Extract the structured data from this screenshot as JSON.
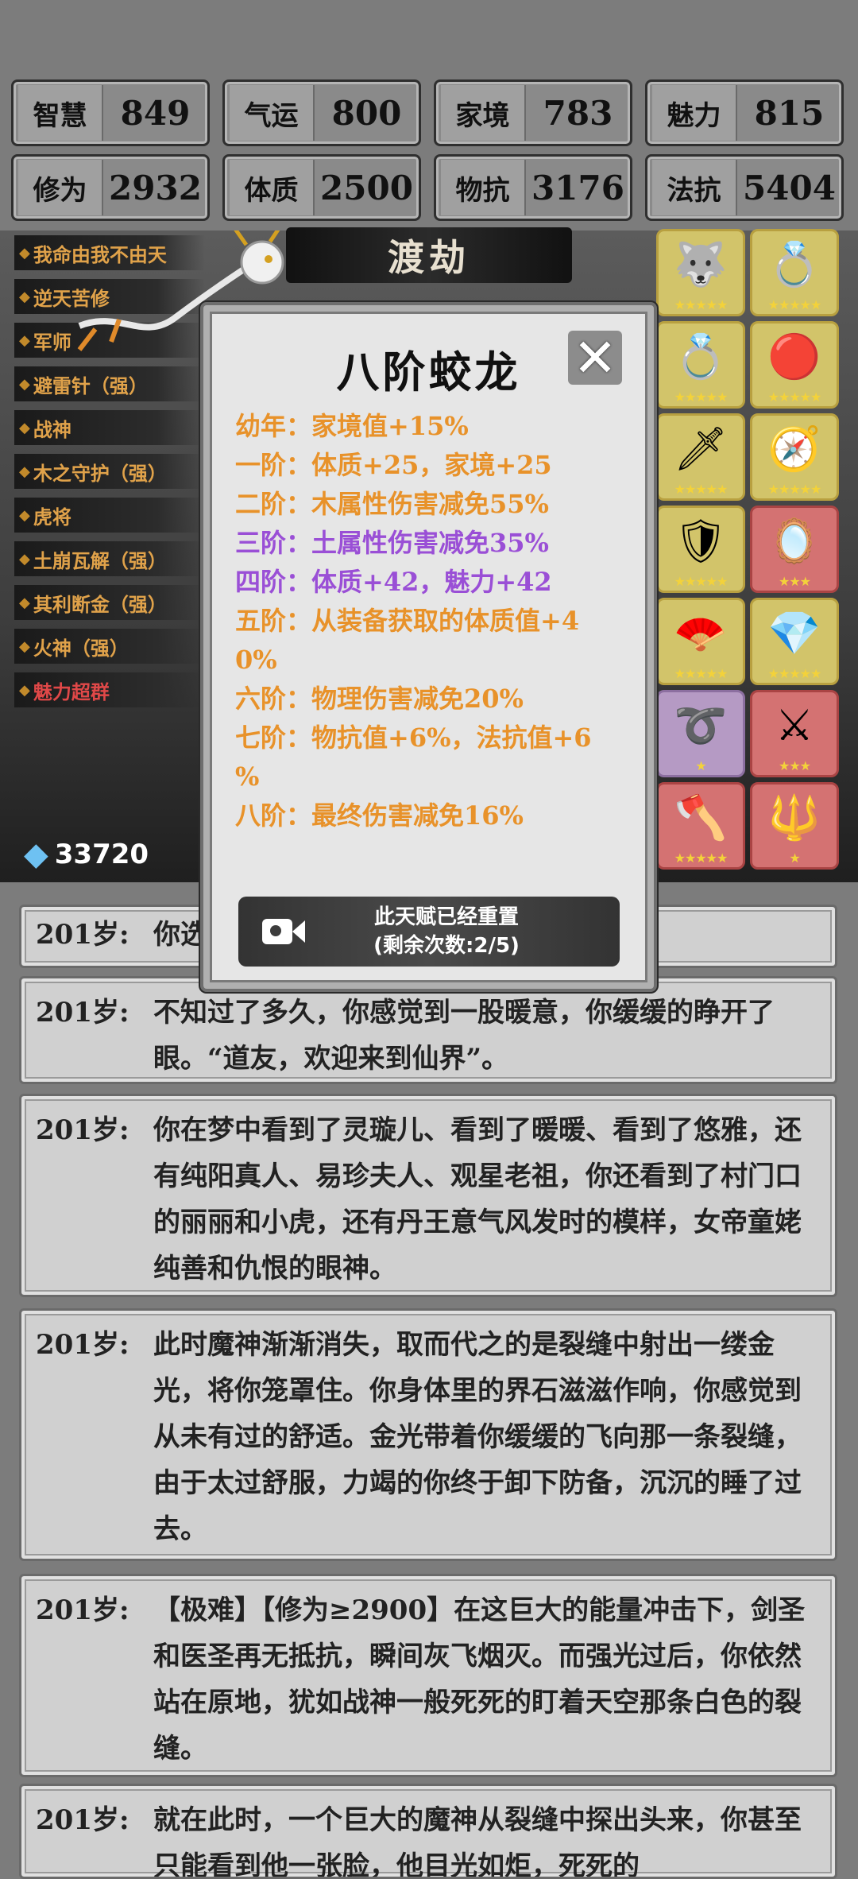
{
  "stats": [
    {
      "label": "智慧",
      "value": "849"
    },
    {
      "label": "气运",
      "value": "800"
    },
    {
      "label": "家境",
      "value": "783"
    },
    {
      "label": "魅力",
      "value": "815"
    },
    {
      "label": "修为",
      "value": "2932"
    },
    {
      "label": "体质",
      "value": "2500"
    },
    {
      "label": "物抗",
      "value": "3176"
    },
    {
      "label": "法抗",
      "value": "5404"
    }
  ],
  "talents": [
    {
      "label": "我命由我不由天"
    },
    {
      "label": "逆天苦修"
    },
    {
      "label": "军师"
    },
    {
      "label": "避雷针（强）"
    },
    {
      "label": "战神"
    },
    {
      "label": "木之守护（强）"
    },
    {
      "label": "虎将"
    },
    {
      "label": "土崩瓦解（强）"
    },
    {
      "label": "其利断金（强）"
    },
    {
      "label": "火神（强）"
    },
    {
      "label": "魅力超群",
      "color": "red"
    }
  ],
  "dujie_label": "渡劫",
  "crystal_count": "33720",
  "items": [
    {
      "icon": "beast-icon",
      "glyph": "🐺",
      "stars": "★★★★★",
      "bg": "gold"
    },
    {
      "icon": "ring-icon",
      "glyph": "💍",
      "stars": "★★★★★",
      "bg": "gold"
    },
    {
      "icon": "ruby-ring-icon",
      "glyph": "💍",
      "stars": "★★★★★",
      "bg": "gold"
    },
    {
      "icon": "red-orb-icon",
      "glyph": "🔴",
      "stars": "★★★★★",
      "bg": "gold"
    },
    {
      "icon": "blade-icon",
      "glyph": "🗡",
      "stars": "★★★★★",
      "bg": "gold"
    },
    {
      "icon": "compass-icon",
      "glyph": "🧭",
      "stars": "★★★★★",
      "bg": "gold"
    },
    {
      "icon": "armor-icon",
      "glyph": "🛡",
      "stars": "★★★★★",
      "bg": "gold"
    },
    {
      "icon": "mirror-icon",
      "glyph": "🪞",
      "stars": "★★★",
      "bg": "red"
    },
    {
      "icon": "fan-icon",
      "glyph": "🪭",
      "stars": "★★★★★",
      "bg": "gold"
    },
    {
      "icon": "crystal-icon",
      "glyph": "💎",
      "stars": "★★★★★",
      "bg": "gold"
    },
    {
      "icon": "whip-icon",
      "glyph": "➰",
      "stars": "★",
      "bg": "purple"
    },
    {
      "icon": "sword-icon",
      "glyph": "⚔",
      "stars": "★★★",
      "bg": "red"
    },
    {
      "icon": "axe-icon",
      "glyph": "🪓",
      "stars": "★★★★★",
      "bg": "red"
    },
    {
      "icon": "spear-icon",
      "glyph": "🔱",
      "stars": "★",
      "bg": "red"
    }
  ],
  "modal": {
    "title": "八阶蛟龙",
    "stages": [
      {
        "text": "幼年：家境值+15%",
        "color": "orange"
      },
      {
        "text": "一阶：体质+25，家境+25",
        "color": "orange"
      },
      {
        "text": "二阶：木属性伤害减免55%",
        "color": "orange"
      },
      {
        "text": "三阶：土属性伤害减免35%",
        "color": "purple"
      },
      {
        "text": "四阶：体质+42，魅力+42",
        "color": "purple"
      },
      {
        "text": "五阶：从装备获取的体质值+4",
        "color": "orange"
      },
      {
        "text": "0%",
        "color": "orange"
      },
      {
        "text": "六阶：物理伤害减免20%",
        "color": "orange"
      },
      {
        "text": "七阶：物抗值+6%，法抗值+6",
        "color": "orange"
      },
      {
        "text": "%",
        "color": "orange"
      },
      {
        "text": "八阶：最终伤害减免16%",
        "color": "orange"
      }
    ],
    "reset_line1": "此天赋已经重置",
    "reset_line2": "(剩余次数:2/5)"
  },
  "log": [
    {
      "age": "201岁:",
      "text": "你选择了飞升"
    },
    {
      "age": "201岁:",
      "text": "不知过了多久，你感觉到一股暖意，你缓缓的睁开了眼。“道友，欢迎来到仙界”。"
    },
    {
      "age": "201岁:",
      "text": "你在梦中看到了灵璇儿、看到了暖暖、看到了悠雅，还有纯阳真人、易珍夫人、观星老祖，你还看到了村门口的丽丽和小虎，还有丹王意气风发时的模样，女帝童姥纯善和仇恨的眼神。"
    },
    {
      "age": "201岁:",
      "text": "此时魔神渐渐消失，取而代之的是裂缝中射出一缕金光，将你笼罩住。你身体里的界石滋滋作响，你感觉到从未有过的舒适。金光带着你缓缓的飞向那一条裂缝，由于太过舒服，力竭的你终于卸下防备，沉沉的睡了过去。"
    },
    {
      "age": "201岁:",
      "text": "【极难】【修为≥2900】在这巨大的能量冲击下，剑圣和医圣再无抵抗，瞬间灰飞烟灭。而强光过后，你依然站在原地，犹如战神一般死死的盯着天空那条白色的裂缝。"
    },
    {
      "age": "201岁:",
      "text": "就在此时，一个巨大的魔神从裂缝中探出头来，你甚至只能看到他一张脸，他目光如炬，死死的"
    }
  ]
}
